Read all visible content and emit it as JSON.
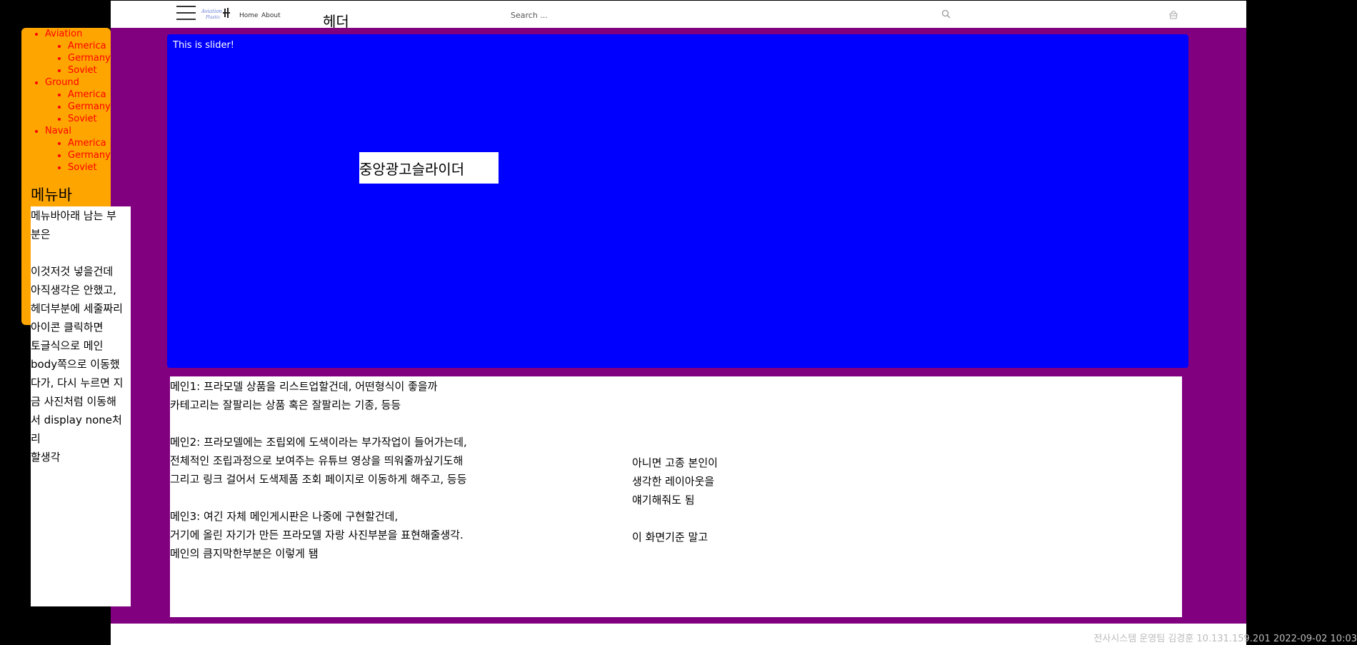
{
  "header": {
    "title": "헤더",
    "nav": {
      "home": "Home",
      "about": "About"
    },
    "search_placeholder": "Search ..."
  },
  "sidebar": {
    "menu": [
      {
        "label": "Aviation",
        "children": [
          "America",
          "Germany",
          "Soviet"
        ]
      },
      {
        "label": "Ground",
        "children": [
          "America",
          "Germany",
          "Soviet"
        ]
      },
      {
        "label": "Naval",
        "children": [
          "America",
          "Germany",
          "Soviet"
        ]
      }
    ],
    "menubar_title": "메뉴바"
  },
  "side_panel": {
    "lines": [
      "메뉴바아래 남는 부",
      "분은",
      "",
      "이것저것 넣을건데",
      "아직생각은 안했고,",
      "헤더부분에 세줄짜리",
      "아이콘 클릭하면",
      "토글식으로 메인",
      "body쪽으로 이동했",
      "다가, 다시 누르면 지",
      "금 사진처럼 이동해",
      "서 display none처리",
      "할생각"
    ]
  },
  "slider": {
    "text": "This is slider!",
    "ad_label": "중앙광고슬라이더"
  },
  "main": {
    "left_lines": [
      "메인1: 프라모델 상품을 리스트업할건데, 어떤형식이 좋을까",
      "카테고리는 잘팔리는 상품 혹은 잘팔리는 기종, 등등",
      "",
      "메인2: 프라모델에는 조립외에 도색이라는 부가작업이 들어가는데,",
      "전체적인 조립과정으로 보여주는 유튜브 영상을 띄워줄까싶기도해",
      "그리고 링크 걸어서 도색제품 조회 페이지로 이동하게 해주고, 등등",
      "",
      "메인3: 여긴 자체 메인게시판은 나중에 구현할건데,",
      "거기에 올린 자기가 만든 프라모델 자랑 사진부분을 표현해줄생각.",
      "메인의 큼지막한부분은 이렇게 됌"
    ],
    "right_lines": [
      "아니면 고종 본인이",
      "생각한 레이아웃을",
      "얘기해줘도 됨",
      "",
      "이 화면기준 말고"
    ]
  },
  "watermark": "전사시스템 운영팀 김경훈 10.131.159.201 2022-09-02 10:03"
}
